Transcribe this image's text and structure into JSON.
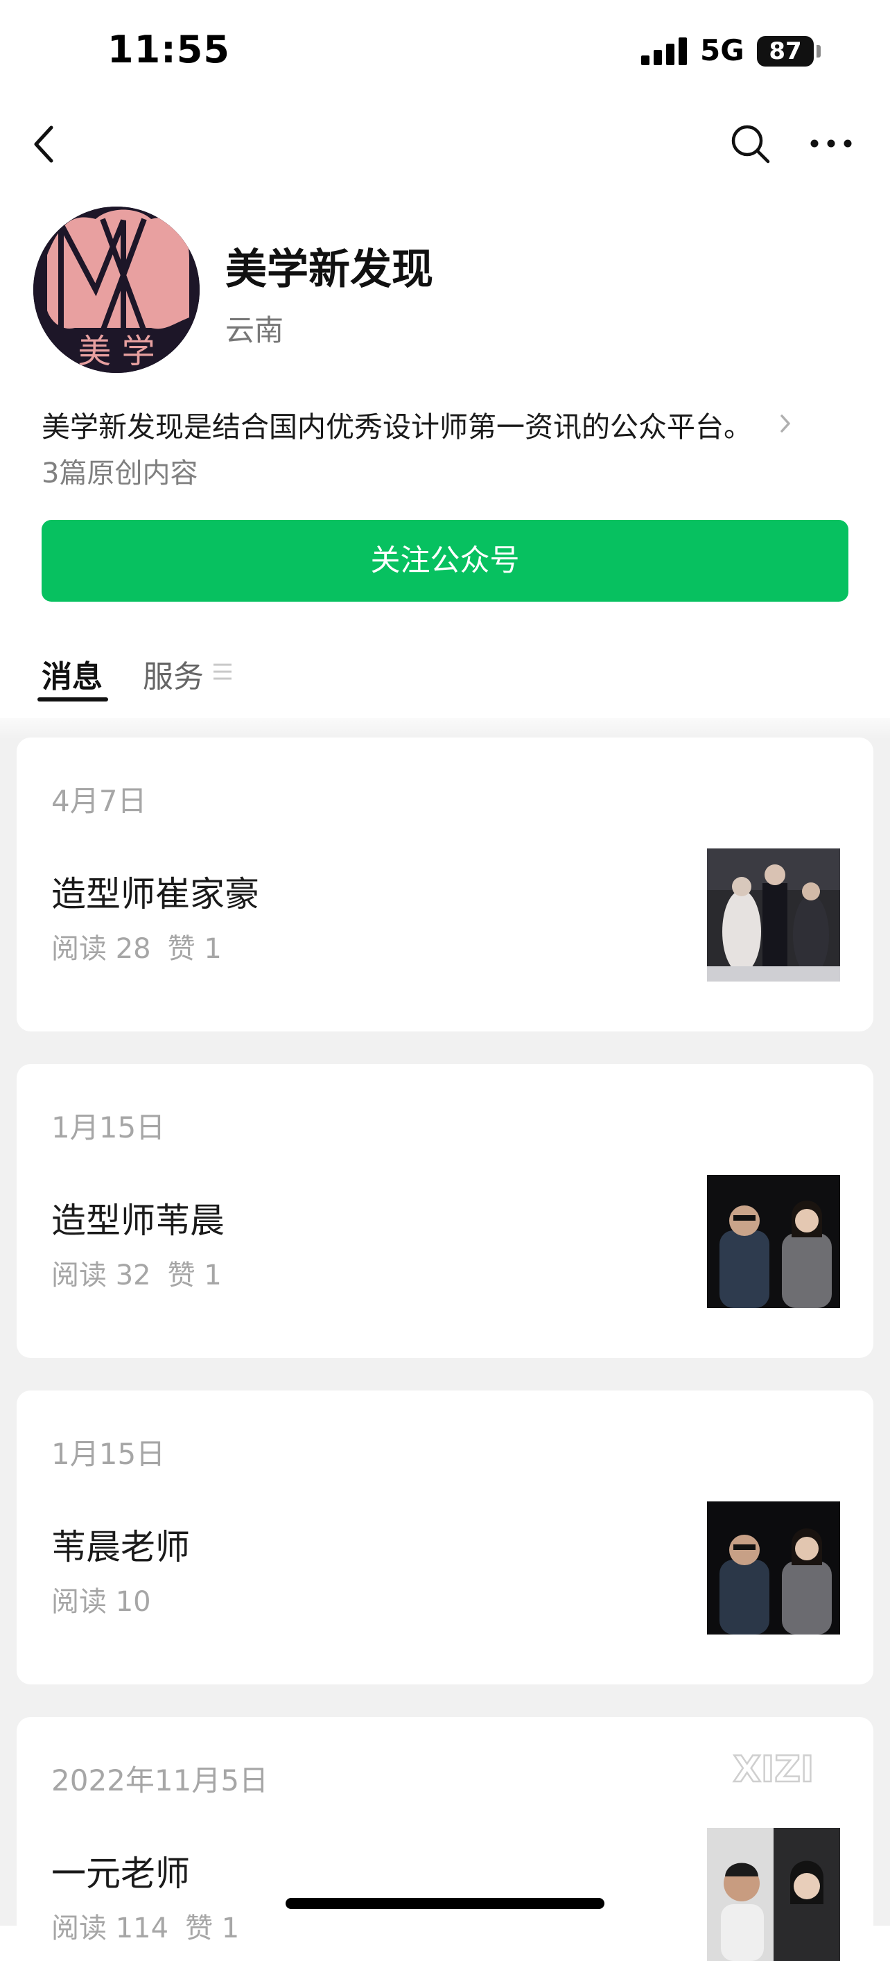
{
  "status_bar": {
    "time": "11:55",
    "network": "5G",
    "battery": "87"
  },
  "nav": {
    "back_icon": "chevron-left-icon",
    "search_icon": "search-icon",
    "more_icon": "more-dots-icon"
  },
  "profile": {
    "name": "美学新发现",
    "location": "云南",
    "avatar_text": "美 学",
    "description": "美学新发现是结合国内优秀设计师第一资讯的公众平台。",
    "original_count": "3篇原创内容",
    "follow_label": "关注公众号",
    "follow_color": "#07c160"
  },
  "tabs": {
    "messages": "消息",
    "services": "服务"
  },
  "articles": [
    {
      "date": "4月7日",
      "title": "造型师崔家豪",
      "reads": "阅读 28",
      "likes": "赞 1"
    },
    {
      "date": "1月15日",
      "title": "造型师苇晨",
      "reads": "阅读 32",
      "likes": "赞 1"
    },
    {
      "date": "1月15日",
      "title": "苇晨老师",
      "reads": "阅读 10",
      "likes": ""
    },
    {
      "date": "2022年11月5日",
      "title": "一元老师",
      "reads": "阅读 114",
      "likes": "赞 1"
    }
  ],
  "watermark": "XIZI"
}
